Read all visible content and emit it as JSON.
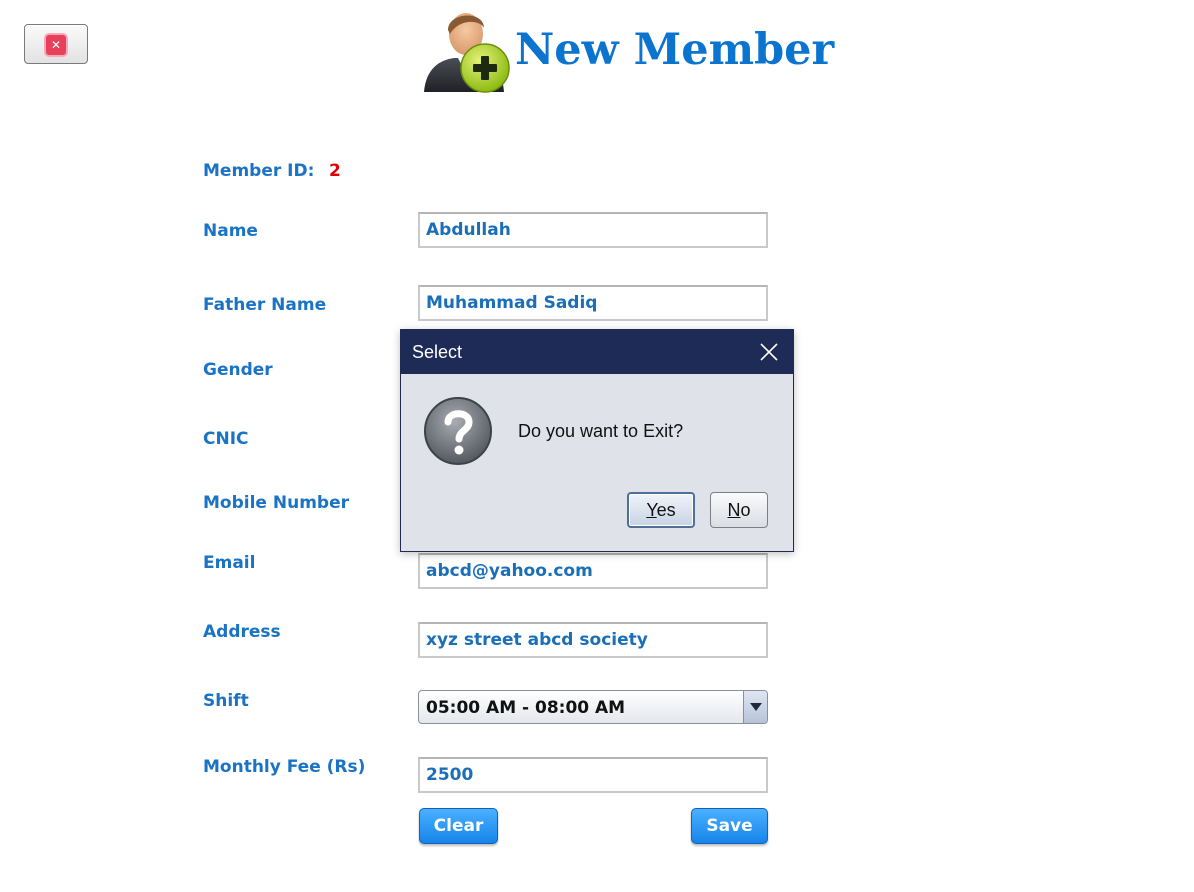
{
  "header": {
    "title": "New Member"
  },
  "form": {
    "member_id_label": "Member ID:",
    "member_id_value": "2",
    "name_label": "Name",
    "name_value": "Abdullah",
    "father_name_label": "Father Name",
    "father_name_value": "Muhammad Sadiq",
    "gender_label": "Gender",
    "cnic_label": "CNIC",
    "mobile_label": "Mobile Number",
    "email_label": "Email",
    "email_value": "abcd@yahoo.com",
    "address_label": "Address",
    "address_value": "xyz street abcd society",
    "shift_label": "Shift",
    "shift_value": "05:00 AM - 08:00 AM",
    "fee_label": "Monthly Fee (Rs)",
    "fee_value": "2500",
    "clear_label": "Clear",
    "save_label": "Save"
  },
  "dialog": {
    "title": "Select",
    "message": "Do you want to Exit?",
    "yes_mnemonic": "Y",
    "yes_rest": "es",
    "no_mnemonic": "N",
    "no_rest": "o"
  },
  "icons": {
    "close_button": "close-icon",
    "header": "add-user-icon",
    "dialog": "question-icon",
    "dialog_close": "close-icon",
    "combo": "chevron-down-icon"
  },
  "colors": {
    "accent": "#1a73c4",
    "title": "#0b74cf",
    "member_id_value": "#e00000",
    "dialog_titlebar": "#1f2b57",
    "button": "#1684ea"
  }
}
